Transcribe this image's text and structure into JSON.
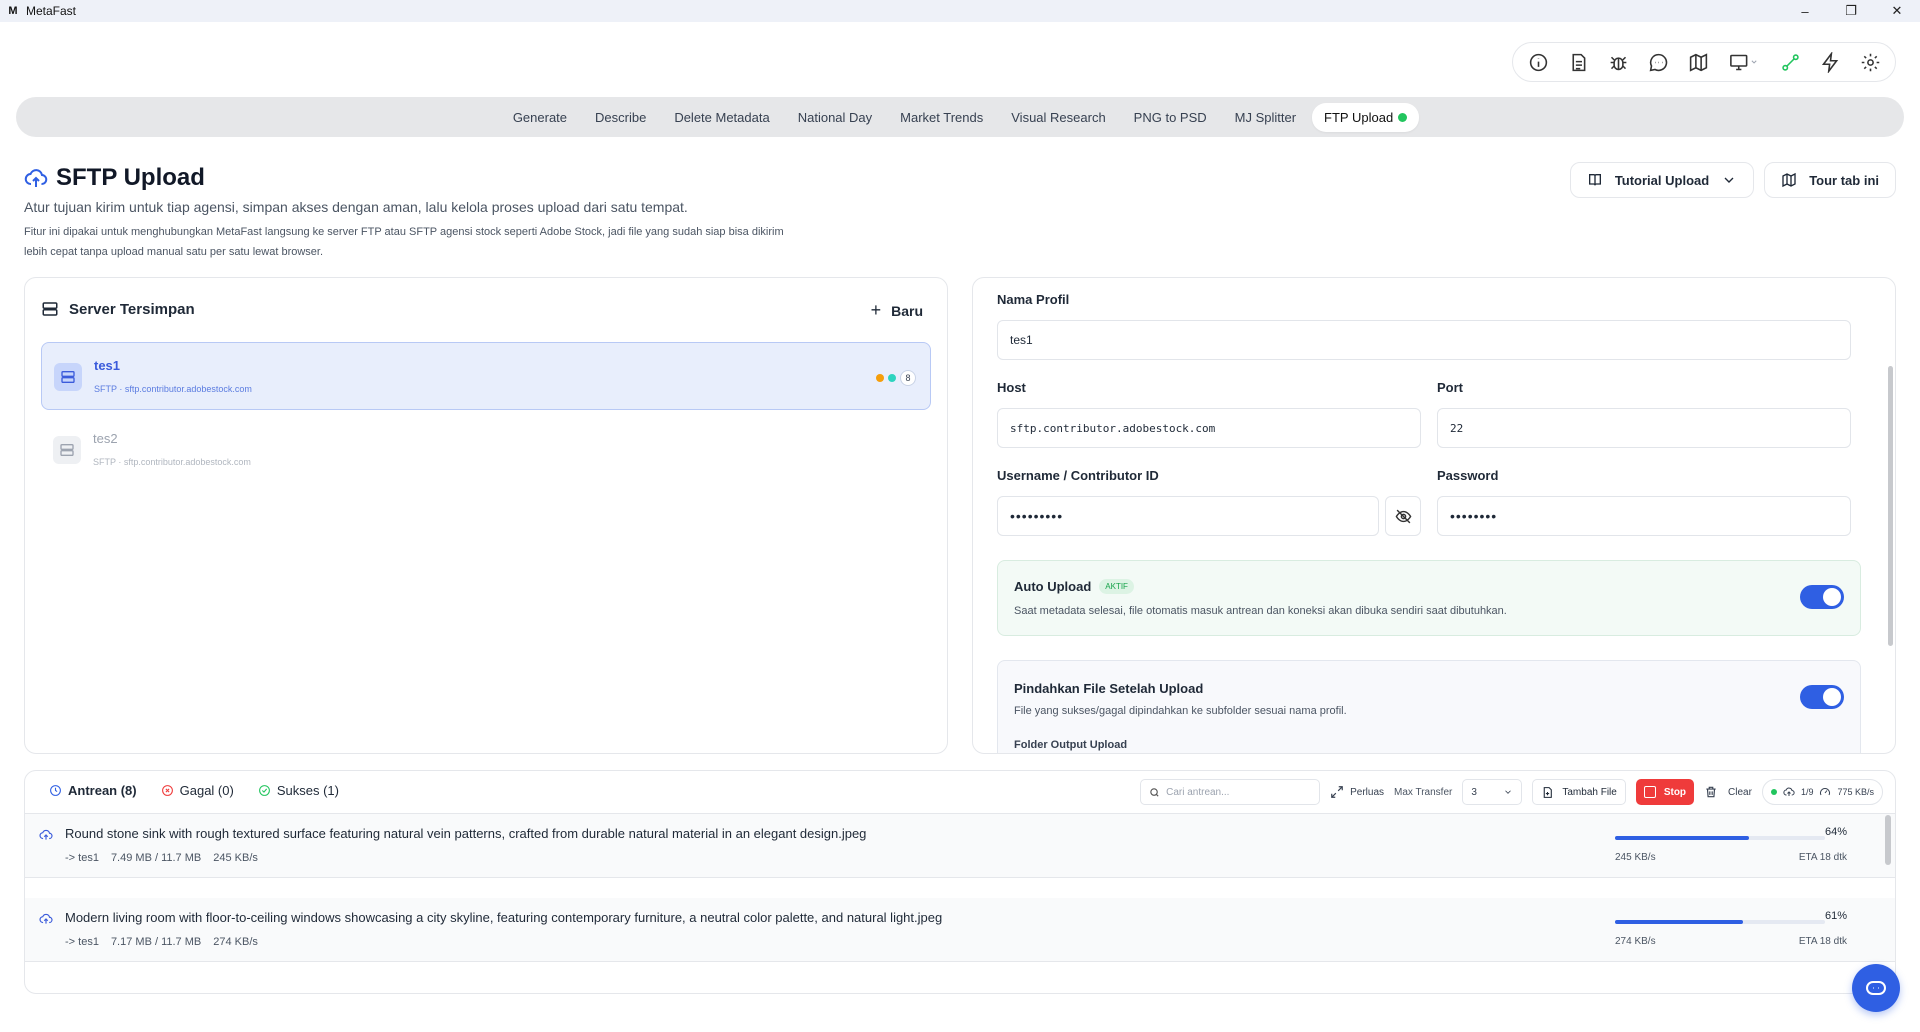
{
  "window": {
    "logo": "M",
    "title": "MetaFast",
    "minimize": "–",
    "maximize": "❐",
    "close": "✕"
  },
  "toolbar_icons": [
    "info-icon",
    "document-icon",
    "bug-icon",
    "chat-icon",
    "map-icon",
    "monitor-icon",
    "connection-icon",
    "lightning-icon",
    "gear-icon"
  ],
  "nav": {
    "tabs": [
      "Generate",
      "Describe",
      "Delete Metadata",
      "National Day",
      "Market Trends",
      "Visual Research",
      "PNG to PSD",
      "MJ Splitter",
      "FTP Upload"
    ],
    "active": "FTP Upload",
    "active_dot_color": "#22c55e"
  },
  "header": {
    "title": "SFTP Upload",
    "subtitle": "Atur tujuan kirim untuk tiap agensi, simpan akses dengan aman, lalu kelola proses upload dari satu tempat.",
    "description": "Fitur ini dipakai untuk menghubungkan MetaFast langsung ke server FTP atau SFTP agensi stock seperti Adobe Stock, jadi file yang sudah siap bisa dikirim lebih cepat tanpa upload manual satu per satu lewat browser.",
    "tutorial_btn": "Tutorial Upload",
    "tour_btn": "Tour tab ini"
  },
  "servers": {
    "title": "Server Tersimpan",
    "new_btn": "Baru",
    "items": [
      {
        "name": "tes1",
        "host": "SFTP · sftp.contributor.adobestock.com",
        "selected": true,
        "badge": "8"
      },
      {
        "name": "tes2",
        "host": "SFTP · sftp.contributor.adobestock.com",
        "selected": false
      }
    ],
    "status_colors": [
      "#f59e0b",
      "#2dd4bf"
    ]
  },
  "form": {
    "profile_label": "Nama Profil",
    "profile_value": "tes1",
    "host_label": "Host",
    "host_value": "sftp.contributor.adobestock.com",
    "port_label": "Port",
    "port_value": "22",
    "username_label": "Username / Contributor ID",
    "username_value": "•••••••••",
    "password_label": "Password",
    "password_value": "••••••••",
    "auto_upload": {
      "title": "Auto Upload",
      "badge": "AKTIF",
      "desc": "Saat metadata selesai, file otomatis masuk antrean dan koneksi akan dibuka sendiri saat dibutuhkan.",
      "on": true
    },
    "move_files": {
      "title": "Pindahkan File Setelah Upload",
      "desc": "File yang sukses/gagal dipindahkan ke subfolder sesuai nama profil.",
      "folder_label": "Folder Output Upload",
      "on": true
    }
  },
  "queue": {
    "tabs": {
      "antrean": "Antrean (8)",
      "gagal": "Gagal (0)",
      "sukses": "Sukses (1)"
    },
    "search_placeholder": "Cari antrean...",
    "expand_label": "Perluas",
    "max_transfer_label": "Max Transfer",
    "max_transfer_value": "3",
    "add_file_btn": "Tambah File",
    "stop_btn": "Stop",
    "clear_btn": "Clear",
    "stat_count": "1/9",
    "stat_speed": "775 KB/s",
    "items": [
      {
        "name": "Round stone sink with rough textured surface featuring natural vein patterns, crafted from durable natural material in an elegant design.jpeg",
        "target": "-> tes1",
        "size": "7.49 MB / 11.7 MB",
        "speed": "245 KB/s",
        "percent_label": "64%",
        "progress": 64,
        "eta": "ETA 18 dtk"
      },
      {
        "name": "Modern living room with floor-to-ceiling windows showcasing a city skyline, featuring contemporary furniture, a neutral color palette, and natural light.jpeg",
        "target": "-> tes1",
        "size": "7.17 MB / 11.7 MB",
        "speed": "274 KB/s",
        "percent_label": "61%",
        "progress": 61,
        "eta": "ETA 18 dtk"
      }
    ]
  },
  "colors": {
    "accent": "#2f5fe3",
    "stop": "#ef3b3b",
    "success": "#22c55e"
  }
}
